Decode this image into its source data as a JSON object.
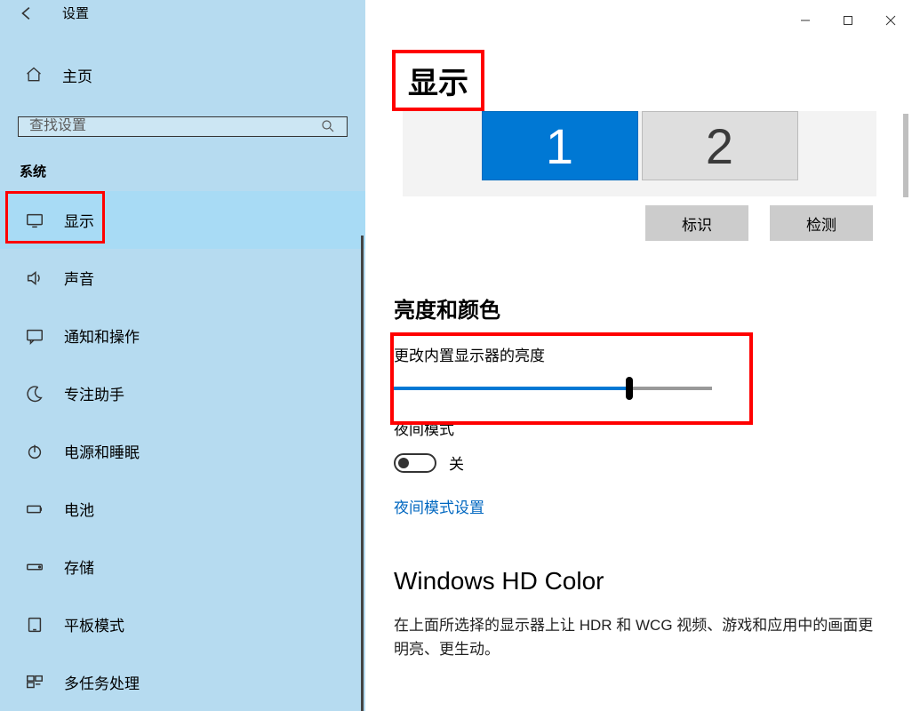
{
  "window": {
    "title": "设置"
  },
  "sidebar": {
    "home": "主页",
    "searchPlaceholder": "查找设置",
    "category": "系统",
    "items": [
      {
        "icon": "monitor",
        "label": "显示",
        "active": true
      },
      {
        "icon": "speaker",
        "label": "声音"
      },
      {
        "icon": "message",
        "label": "通知和操作"
      },
      {
        "icon": "moon",
        "label": "专注助手"
      },
      {
        "icon": "power",
        "label": "电源和睡眠"
      },
      {
        "icon": "battery",
        "label": "电池"
      },
      {
        "icon": "storage",
        "label": "存储"
      },
      {
        "icon": "tablet",
        "label": "平板模式"
      },
      {
        "icon": "multitask",
        "label": "多任务处理"
      }
    ]
  },
  "main": {
    "title": "显示",
    "monitors": [
      "1",
      "2"
    ],
    "identifyBtn": "标识",
    "detectBtn": "检测",
    "brightnessSection": "亮度和颜色",
    "brightnessLabel": "更改内置显示器的亮度",
    "brightnessValue": 74,
    "nightModeLabel": "夜间模式",
    "nightModeState": "关",
    "nightModeLink": "夜间模式设置",
    "hdTitle": "Windows HD Color",
    "hdDesc": "在上面所选择的显示器上让 HDR 和 WCG 视频、游戏和应用中的画面更明亮、更生动。"
  }
}
